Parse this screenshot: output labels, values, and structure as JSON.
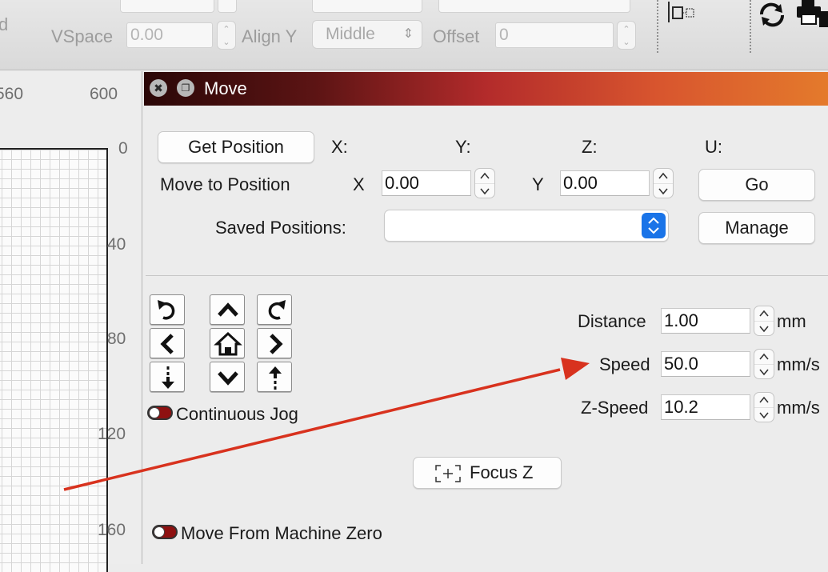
{
  "toolbar": {
    "partial_left_label": "d",
    "vspace_label": "VSpace",
    "vspace_value": "0.00",
    "align_y_label": "Align Y",
    "align_y_value": "Middle",
    "offset_label": "Offset",
    "offset_value": "0",
    "icons": [
      "align-icon",
      "rotate-refresh-icon",
      "printer-icon"
    ]
  },
  "ruler": {
    "top_ticks": [
      "560",
      "600"
    ],
    "left_ticks": [
      "0",
      "40",
      "80",
      "120",
      "160"
    ]
  },
  "move_panel": {
    "title": "Move",
    "get_position_label": "Get Position",
    "axis_x_label": "X:",
    "axis_y_label": "Y:",
    "axis_z_label": "Z:",
    "axis_u_label": "U:",
    "move_to_position_label": "Move to Position",
    "x_label": "X",
    "x_value": "0.00",
    "y_label": "Y",
    "y_value": "0.00",
    "go_label": "Go",
    "saved_positions_label": "Saved Positions:",
    "saved_positions_value": "",
    "manage_label": "Manage",
    "distance_label": "Distance",
    "distance_value": "1.00",
    "distance_unit": "mm",
    "speed_label": "Speed",
    "speed_value": "50.0",
    "speed_unit": "mm/s",
    "zspeed_label": "Z-Speed",
    "zspeed_value": "10.2",
    "zspeed_unit": "mm/s",
    "continuous_jog_label": "Continuous Jog",
    "focus_z_label": "Focus Z",
    "move_from_machine_zero_label": "Move From Machine Zero"
  },
  "colors": {
    "titlebar_start": "#2a0707",
    "titlebar_end": "#e47a2c",
    "select_accent": "#1a74e8",
    "toggle_on": "#8e1111",
    "annotation_arrow": "#d8321e"
  }
}
